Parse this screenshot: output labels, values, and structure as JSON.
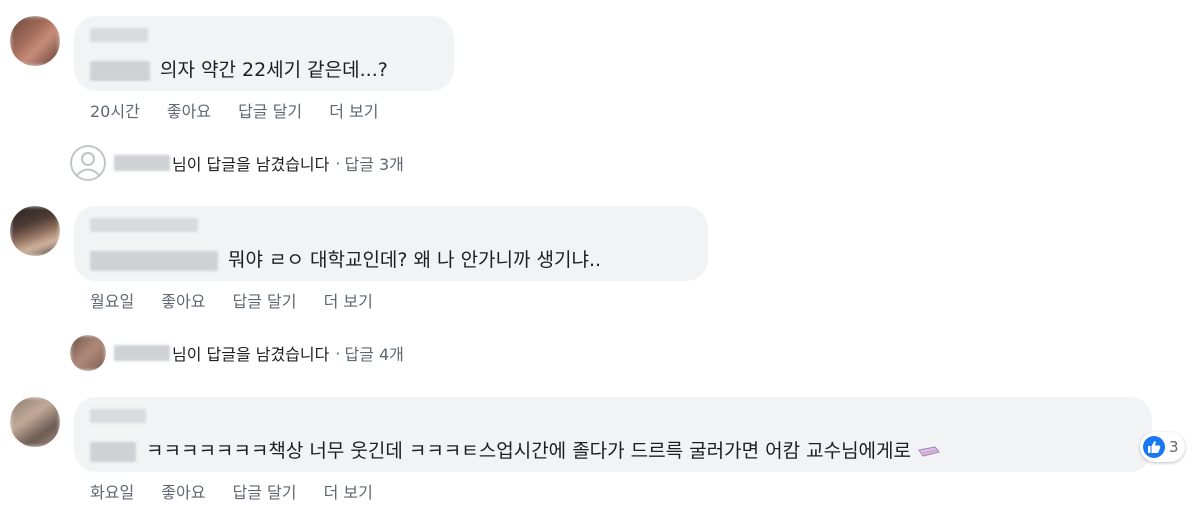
{
  "comments": [
    {
      "text": "의자 약간 22세기 같은데...?",
      "time": "20시간",
      "like": "좋아요",
      "reply": "답글 달기",
      "more": "더 보기"
    },
    {
      "text": "뭐야 ㄹㅇ 대학교인데? 왜 나 안가니까 생기냐..",
      "time": "월요일",
      "like": "좋아요",
      "reply": "답글 달기",
      "more": "더 보기"
    },
    {
      "text": "ㅋㅋㅋㅋㅋㅋㅋ책상 너무 웃긴데 ㅋㅋㅋㅌ스업시간에 졸다가 드르륵 굴러가면 어캄 교수님에게로 ",
      "time": "화요일",
      "like": "좋아요",
      "reply": "답글 달기",
      "more": "더 보기",
      "reaction_count": "3"
    }
  ],
  "replies": [
    {
      "text": "님이 답글을 남겼습니다",
      "sep": "·",
      "count": "답글 3개"
    },
    {
      "text": "님이 답글을 남겼습니다",
      "sep": "·",
      "count": "답글 4개"
    }
  ],
  "colors": {
    "bubble": "#f2f3f5",
    "meta": "#606770",
    "like_blue": "#1877f2"
  }
}
